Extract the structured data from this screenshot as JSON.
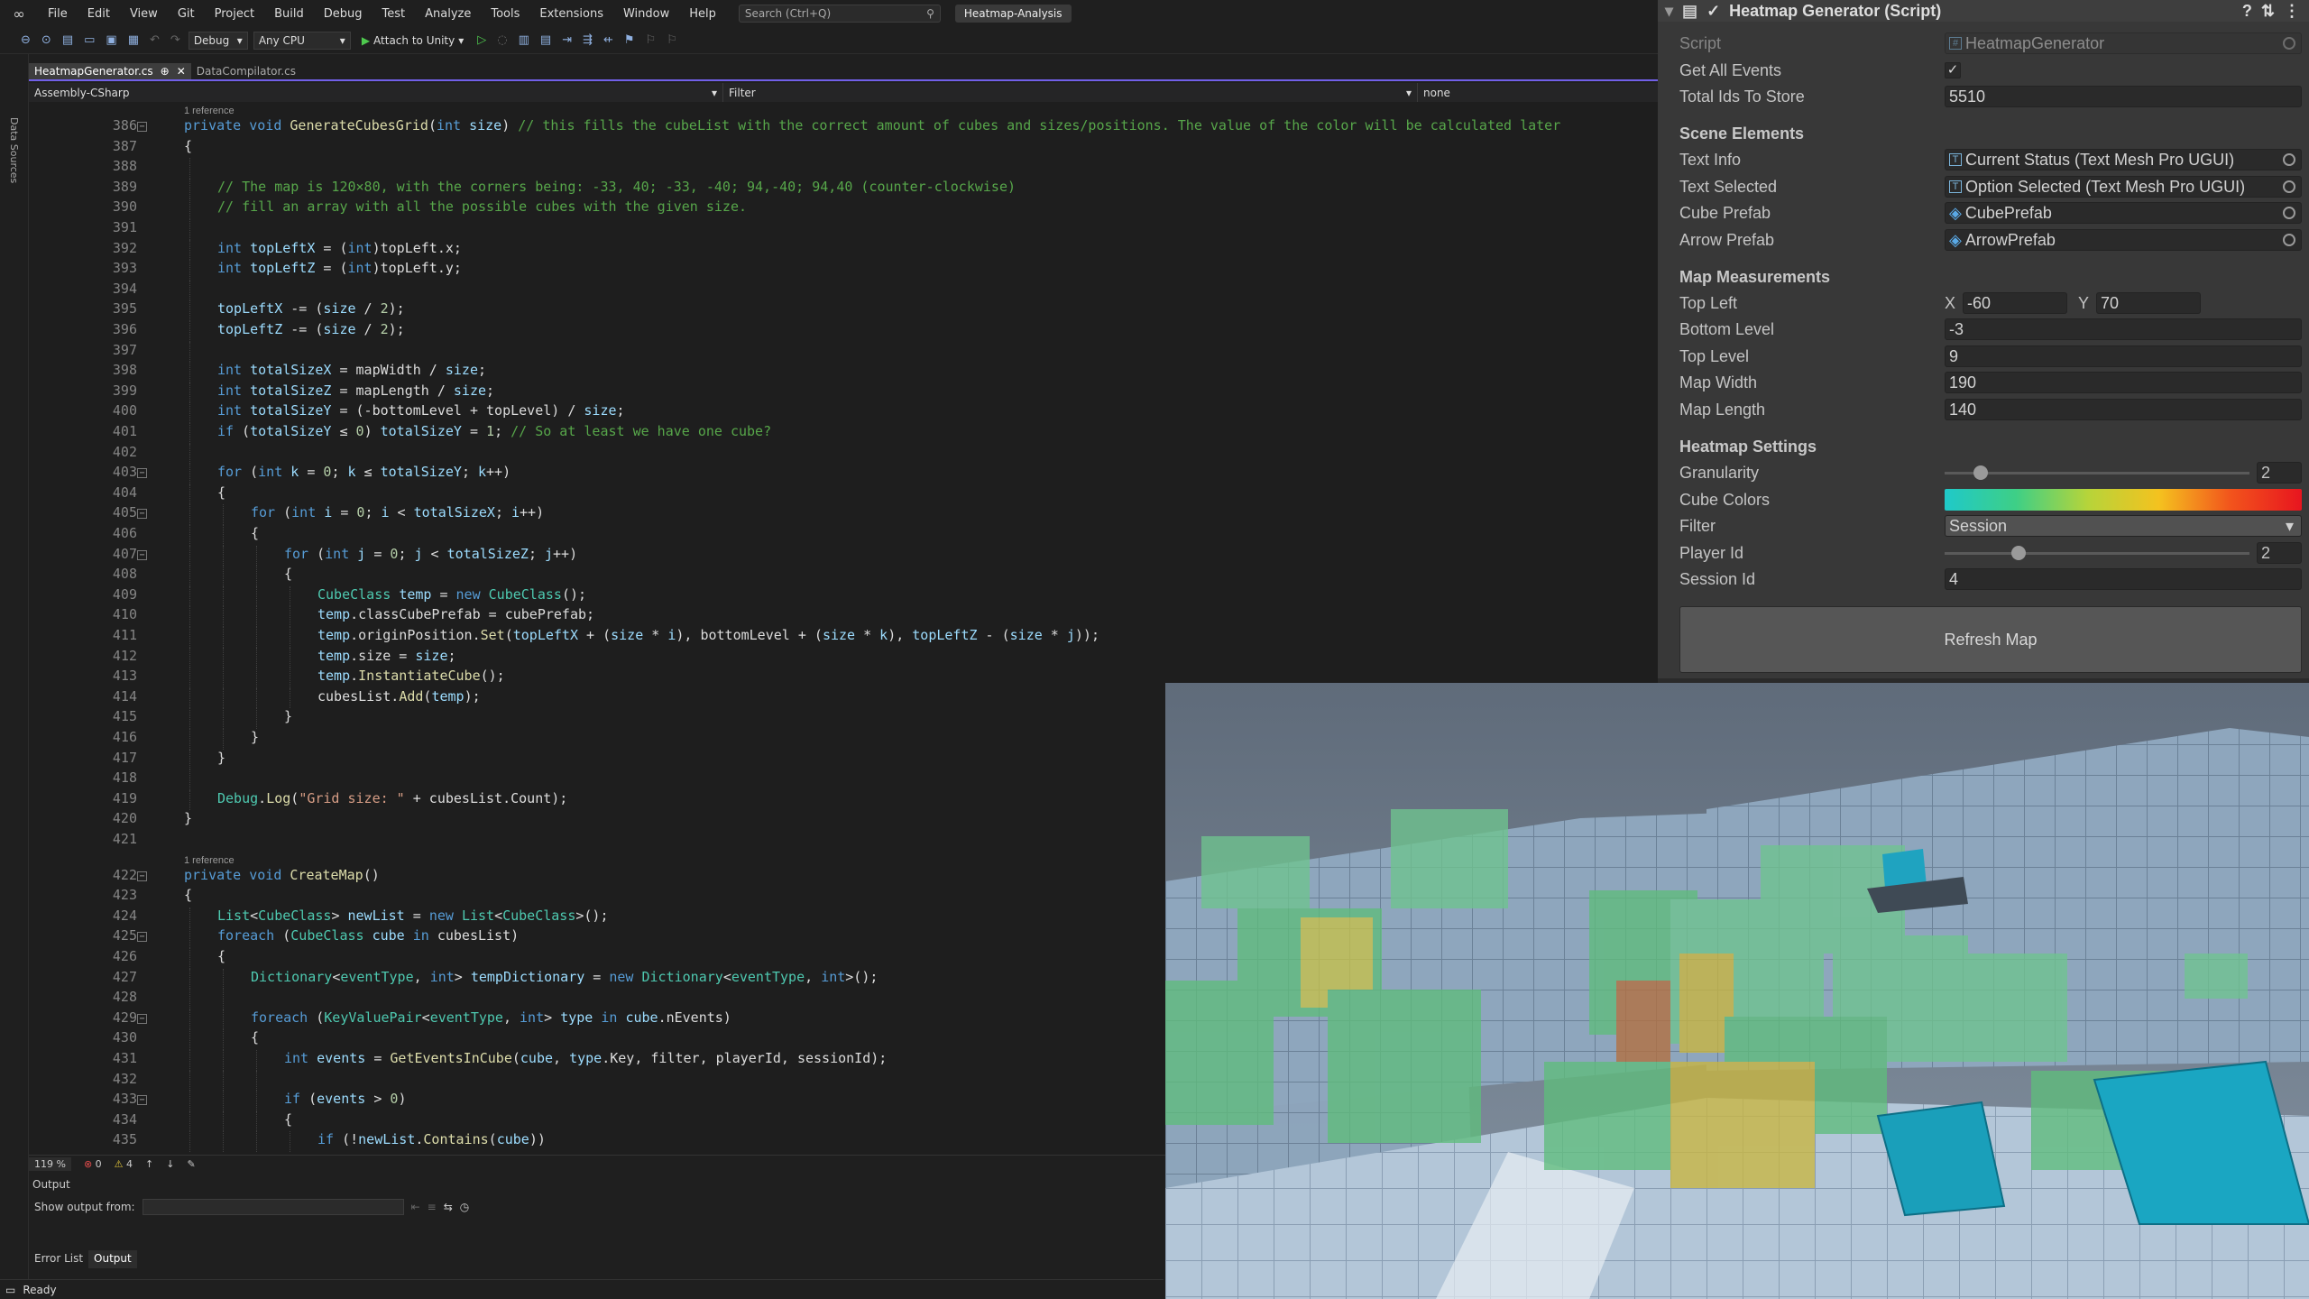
{
  "menubar": {
    "logo_icon": "visual-studio-logo-icon",
    "items": [
      "File",
      "Edit",
      "View",
      "Git",
      "Project",
      "Build",
      "Debug",
      "Test",
      "Analyze",
      "Tools",
      "Extensions",
      "Window",
      "Help"
    ],
    "search_placeholder": "Search (Ctrl+Q)",
    "solution_name": "Heatmap-Analysis"
  },
  "toolbar": {
    "config": "Debug",
    "platform": "Any CPU",
    "attach_label": "Attach to Unity"
  },
  "left_strip": {
    "label": "Data Sources"
  },
  "tabs": [
    {
      "label": "HeatmapGenerator.cs",
      "pin": "⊕",
      "close": "✕",
      "active": true
    },
    {
      "label": "DataCompilator.cs",
      "active": false
    }
  ],
  "navbar": {
    "project": "Assembly-CSharp",
    "filter": "Filter",
    "member": "none"
  },
  "editor": {
    "lines": [
      {
        "n": "386",
        "ref": "1 reference"
      },
      {
        "n": "387"
      },
      {
        "n": "388"
      },
      {
        "n": "389"
      },
      {
        "n": "390"
      },
      {
        "n": "391"
      },
      {
        "n": "392"
      },
      {
        "n": "393"
      },
      {
        "n": "394"
      },
      {
        "n": "395"
      },
      {
        "n": "396"
      },
      {
        "n": "397"
      },
      {
        "n": "398"
      },
      {
        "n": "399"
      },
      {
        "n": "400"
      },
      {
        "n": "401"
      },
      {
        "n": "402"
      },
      {
        "n": "403"
      },
      {
        "n": "404"
      },
      {
        "n": "405"
      },
      {
        "n": "406"
      },
      {
        "n": "407"
      },
      {
        "n": "408"
      },
      {
        "n": "409"
      },
      {
        "n": "410"
      },
      {
        "n": "411"
      },
      {
        "n": "412"
      },
      {
        "n": "413"
      },
      {
        "n": "414"
      },
      {
        "n": "415"
      },
      {
        "n": "416"
      },
      {
        "n": "417"
      },
      {
        "n": "418"
      },
      {
        "n": "419"
      },
      {
        "n": "420"
      },
      {
        "n": "421"
      },
      {
        "n": "422",
        "ref": "1 reference"
      },
      {
        "n": "423"
      },
      {
        "n": "424"
      },
      {
        "n": "425"
      },
      {
        "n": "426"
      },
      {
        "n": "427"
      },
      {
        "n": "428"
      },
      {
        "n": "429"
      },
      {
        "n": "430"
      },
      {
        "n": "431"
      },
      {
        "n": "432"
      },
      {
        "n": "433"
      },
      {
        "n": "434"
      },
      {
        "n": "435"
      }
    ]
  },
  "edstatus": {
    "zoom": "119 %",
    "errors": "0",
    "warnings": "4"
  },
  "output": {
    "title": "Output",
    "show_from_label": "Show output from:",
    "tabs": [
      "Error List",
      "Output"
    ]
  },
  "statusbar": {
    "text": "Ready"
  },
  "inspector": {
    "title": "Heatmap Generator (Script)",
    "script_label": "Script",
    "script_value": "HeatmapGenerator",
    "get_all_events_label": "Get All Events",
    "get_all_events_checked": true,
    "total_ids_label": "Total Ids To Store",
    "total_ids_value": "5510",
    "scene_elements_header": "Scene Elements",
    "text_info_label": "Text Info",
    "text_info_value": "Current Status (Text Mesh Pro UGUI)",
    "text_selected_label": "Text Selected",
    "text_selected_value": "Option Selected (Text Mesh Pro UGUI)",
    "cube_prefab_label": "Cube Prefab",
    "cube_prefab_value": "CubePrefab",
    "arrow_prefab_label": "Arrow Prefab",
    "arrow_prefab_value": "ArrowPrefab",
    "map_header": "Map Measurements",
    "top_left_label": "Top Left",
    "top_left_x_label": "X",
    "top_left_x": "-60",
    "top_left_y_label": "Y",
    "top_left_y": "70",
    "bottom_level_label": "Bottom Level",
    "bottom_level": "-3",
    "top_level_label": "Top Level",
    "top_level": "9",
    "map_width_label": "Map Width",
    "map_width": "190",
    "map_length_label": "Map Length",
    "map_length": "140",
    "heatmap_header": "Heatmap Settings",
    "granularity_label": "Granularity",
    "granularity": "2",
    "granularity_fraction": 0.1,
    "cube_colors_label": "Cube Colors",
    "gradient_colors": [
      "#1fc9c9",
      "#3ecf86",
      "#b6d43a",
      "#f4c21f",
      "#f2541c",
      "#e8151f"
    ],
    "filter_label": "Filter",
    "filter_value": "Session",
    "player_id_label": "Player Id",
    "player_id": "2",
    "player_id_fraction": 0.23,
    "session_id_label": "Session Id",
    "session_id": "4",
    "refresh_label": "Refresh Map"
  }
}
